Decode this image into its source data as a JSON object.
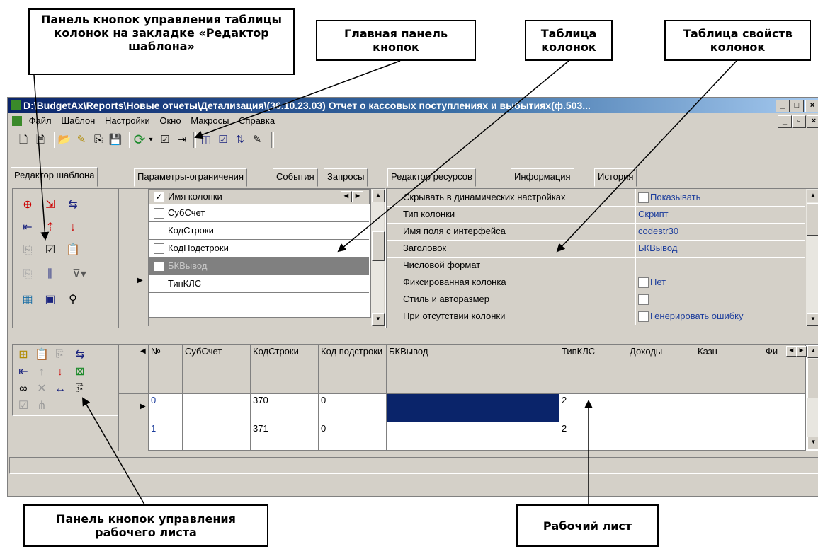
{
  "callouts": {
    "column_buttons": "Панель кнопок управления таблицы колонок на закладке «Редактор шаблона»",
    "main_toolbar": "Главная панель кнопок",
    "column_table": "Таблица колонок",
    "column_props": "Таблица свойств колонок",
    "sheet_buttons": "Панель кнопок управления рабочего листа",
    "worksheet": "Рабочий лист"
  },
  "window": {
    "title": "D:\\BudgetAx\\Reports\\Новые отчеты\\Детализация\\(36.10.23.03) Отчет о кассовых поступлениях и выбытиях(ф.503...",
    "min": "_",
    "max": "□",
    "close": "×"
  },
  "menu": [
    "Файл",
    "Шаблон",
    "Настройки",
    "Окно",
    "Макросы",
    "Справка"
  ],
  "tabs": [
    "Редактор шаблона",
    "Параметры-ограничения",
    "События",
    "Запросы",
    "Редактор ресурсов",
    "Информация",
    "История"
  ],
  "columns_table": {
    "header": "Имя колонки",
    "rows": [
      "СубСчет",
      "КодСтроки",
      "КодПодстроки",
      "БКВывод",
      "ТипКЛС"
    ]
  },
  "props": [
    {
      "name": "Скрывать в динамических настройках",
      "value": "Показывать",
      "checkbox": true
    },
    {
      "name": "Тип колонки",
      "value": "Скрипт",
      "checkbox": false
    },
    {
      "name": "Имя поля с интерфейса",
      "value": "codestr30",
      "checkbox": false
    },
    {
      "name": "Заголовок",
      "value": "БКВывод",
      "checkbox": false
    },
    {
      "name": "Числовой формат",
      "value": "",
      "checkbox": false
    },
    {
      "name": "Фиксированная колонка",
      "value": "Нет",
      "checkbox": true
    },
    {
      "name": "Стиль и авторазмер",
      "value": "",
      "checkbox": true
    },
    {
      "name": "При отсутствии колонки",
      "value": "Генерировать ошибку",
      "checkbox": true
    }
  ],
  "sheet": {
    "headers": [
      "№",
      "СубСчет",
      "КодСтроки",
      "Код подстроки",
      "БКВывод",
      "ТипКЛС",
      "Доходы",
      "Казн",
      "Фи"
    ],
    "rows": [
      [
        "0",
        "",
        "370",
        "0",
        "",
        "2",
        "",
        "",
        ""
      ],
      [
        "1",
        "",
        "371",
        "0",
        "",
        "2",
        "",
        "",
        ""
      ]
    ]
  }
}
